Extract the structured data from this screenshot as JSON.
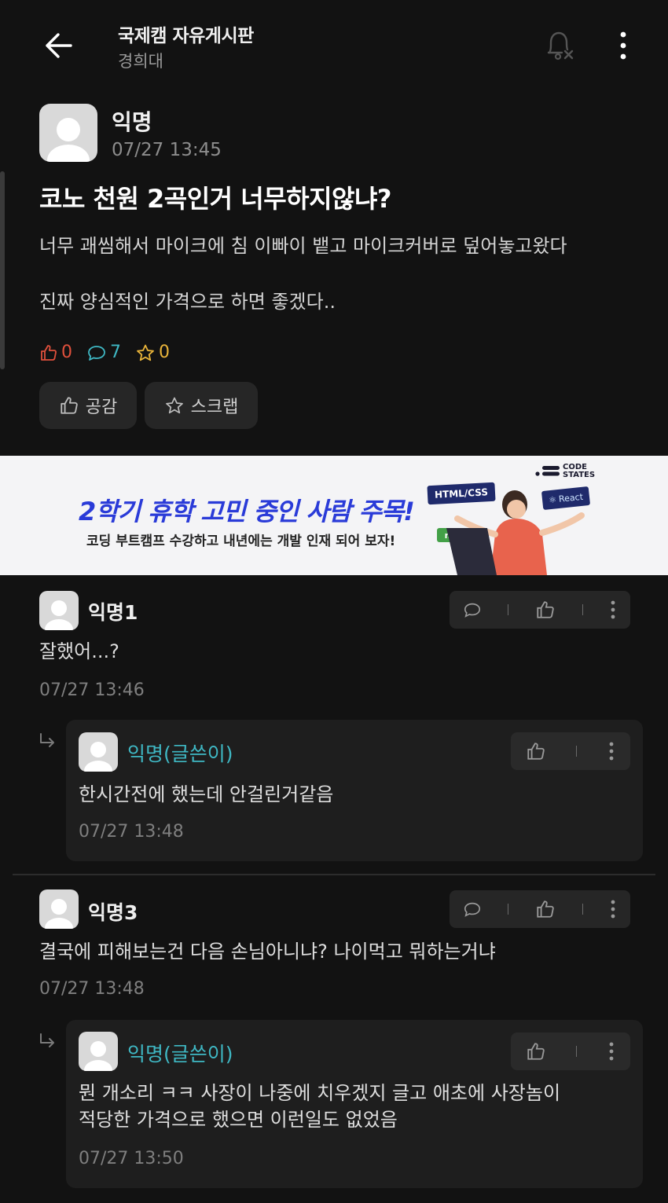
{
  "header": {
    "board_title": "국제캠 자유게시판",
    "board_subtitle": "경희대"
  },
  "post": {
    "author": "익명",
    "time": "07/27 13:45",
    "title": "코노 천원 2곡인거 너무하지않냐?",
    "body_line1": "너무 괘씸해서 마이크에 침 이빠이 뱉고 마이크커버로 덮어놓고왔다",
    "body_line2": "진짜 양심적인 가격으로 하면 좋겠다..",
    "stats": {
      "likes": "0",
      "comments": "7",
      "scraps": "0"
    },
    "like_button": "공감",
    "scrap_button": "스크랩"
  },
  "banner": {
    "headline": "2학기 휴학 고민 중인 사람 주목!",
    "subline": "코딩 부트캠프 수강하고 내년에는 개발 인재 되어 보자!",
    "brand_line1": "CODE",
    "brand_line2": "STATES",
    "tag_html": "HTML/CSS",
    "tag_react": "React",
    "tag_node": "node"
  },
  "comments": [
    {
      "author": "익명1",
      "text": "잘했어...?",
      "time": "07/27 13:46"
    },
    {
      "author": "익명(글쓴이)",
      "text": "한시간전에 했는데 안걸린거같음",
      "time": "07/27 13:48"
    },
    {
      "author": "익명3",
      "text": "결국에 피해보는건 다음 손님아니냐? 나이먹고 뭐하는거냐",
      "time": "07/27 13:48"
    },
    {
      "author": "익명(글쓴이)",
      "text_line1": "뭔 개소리 ㅋㅋ 사장이 나중에 치우겠지 글고 애초에 사장놈이",
      "text_line2": "적당한 가격으로 했으면 이런일도 없었음",
      "time": "07/27 13:50"
    }
  ],
  "colors": {
    "background": "#121212",
    "like_red": "#e0503c",
    "comment_cyan": "#3fb8c4",
    "scrap_yellow": "#e9b43a",
    "op_name": "#3fb8c4",
    "banner_blue": "#2a3bd8"
  }
}
